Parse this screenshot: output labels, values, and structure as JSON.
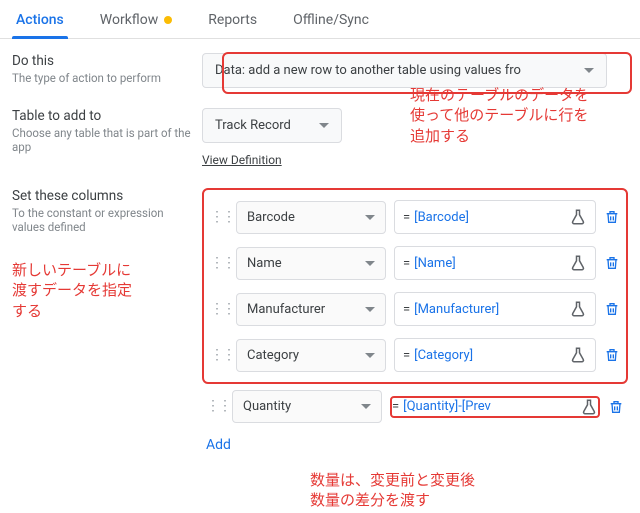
{
  "tabs": {
    "actions": "Actions",
    "workflow": "Workflow",
    "reports": "Reports",
    "offline": "Offline/Sync"
  },
  "doThis": {
    "title": "Do this",
    "sub": "The type of action to perform",
    "value": "Data: add a new row to another table using values fro"
  },
  "tableTo": {
    "title": "Table to add to",
    "sub": "Choose any table that is part of the app",
    "value": "Track Record",
    "viewDef": "View Definition"
  },
  "setCols": {
    "title": "Set these columns",
    "sub": "To the constant or expression values defined",
    "rows": [
      {
        "col": "Barcode",
        "expr": "[Barcode]"
      },
      {
        "col": "Name",
        "expr": "[Name]"
      },
      {
        "col": "Manufacturer",
        "expr": "[Manufacturer]"
      },
      {
        "col": "Category",
        "expr": "[Category]"
      }
    ],
    "extraRow": {
      "col": "Quantity",
      "expr": "[Quantity]-[Prev"
    },
    "add": "Add"
  },
  "anno": {
    "top": "現在のテーブルのデータを\n使って他のテーブルに行を\n追加する",
    "left": "新しいテーブルに\n渡すデータを指定\nする",
    "bot": "数量は、変更前と変更後\n数量の差分を渡す"
  }
}
